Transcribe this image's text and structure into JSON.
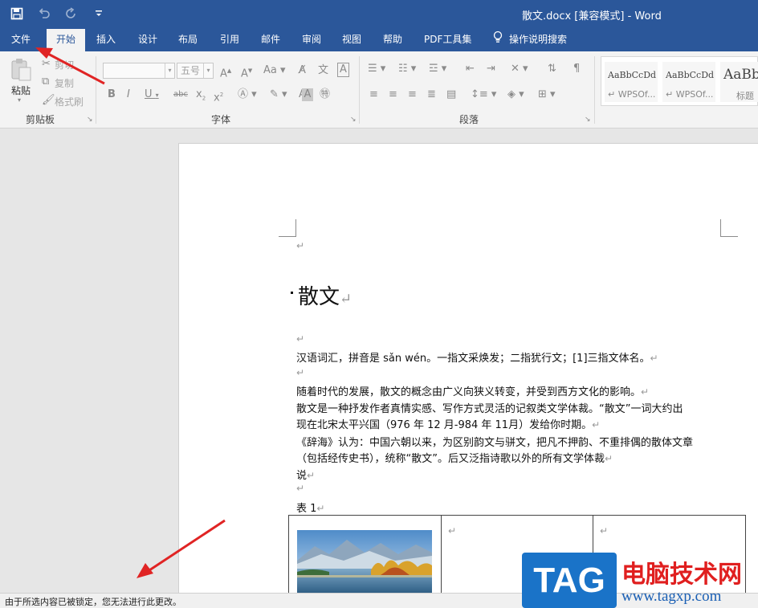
{
  "titlebar": {
    "title": "散文.docx [兼容模式]  -  Word",
    "qat": {
      "save_icon": "save-icon",
      "undo_icon": "undo-icon",
      "redo_icon": "redo-icon",
      "customize_icon": "customize-icon"
    }
  },
  "menu": {
    "tabs": [
      "文件",
      "开始",
      "插入",
      "设计",
      "布局",
      "引用",
      "邮件",
      "审阅",
      "视图",
      "帮助",
      "PDF工具集"
    ],
    "active": "开始",
    "search_label": "操作说明搜索",
    "search_icon": "lightbulb-icon"
  },
  "ribbon": {
    "clipboard": {
      "label": "剪贴板",
      "paste": "粘贴",
      "cut": "剪切",
      "copy": "复制",
      "format_painter": "格式刷"
    },
    "font": {
      "label": "字体",
      "font_size": "五号"
    },
    "paragraph": {
      "label": "段落"
    },
    "styles": [
      "AaBbCcDd",
      "AaBbCcDd",
      "AaBb"
    ],
    "style_names": [
      "WPSOf...",
      "WPSOf...",
      "标题"
    ]
  },
  "document": {
    "heading": "散文",
    "lines": [
      "汉语词汇，拼音是 sǎn wén。一指文采焕发；二指犹行文；[1]三指文体名。",
      "随着时代的发展，散文的概念由广义向狭义转变，并受到西方文化的影响。",
      "散文是一种抒发作者真情实感、写作方式灵活的记叙类文学体裁。“散文”一词大约出",
      "现在北宋太平兴国（976 年 12 月-984 年 11月）发给你时期。",
      "《辞海》认为：中国六朝以来，为区别韵文与骈文，把凡不押韵、不重排偶的散体文章",
      "（包括经传史书），统称“散文”。后又泛指诗歌以外的所有文学体裁",
      "说"
    ],
    "table_caption": "表 1"
  },
  "status": {
    "message": "由于所选内容已被锁定，您无法进行此更改。"
  },
  "watermark": {
    "logo": "TAG",
    "site_name": "电脑技术网",
    "url": "www.tagxp.com"
  },
  "colors": {
    "brand": "#2b579a",
    "arrow": "#e02424"
  }
}
